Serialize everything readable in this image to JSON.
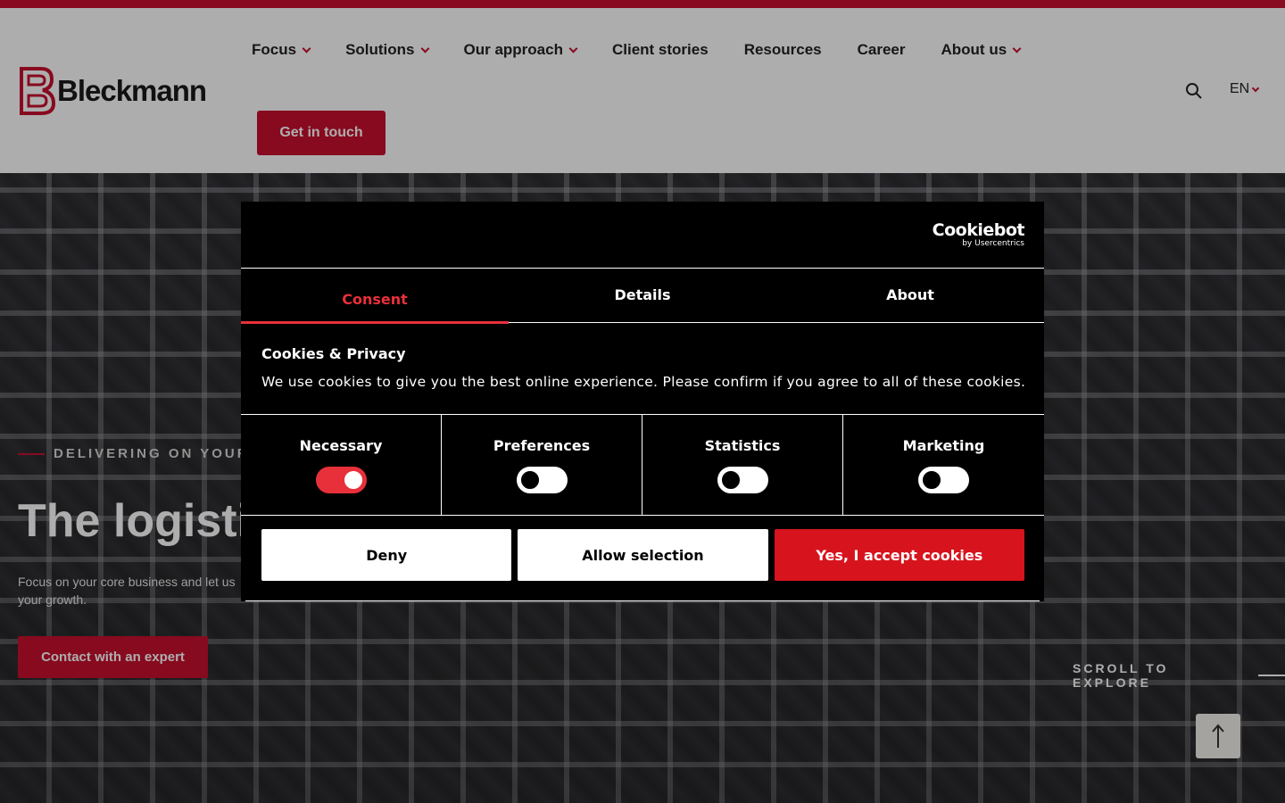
{
  "header": {
    "logo_text": "Bleckmann",
    "nav": [
      {
        "label": "Focus",
        "has_dropdown": true
      },
      {
        "label": "Solutions",
        "has_dropdown": true
      },
      {
        "label": "Our approach",
        "has_dropdown": true
      },
      {
        "label": "Client stories",
        "has_dropdown": false
      },
      {
        "label": "Resources",
        "has_dropdown": false
      },
      {
        "label": "Career",
        "has_dropdown": false
      },
      {
        "label": "About us",
        "has_dropdown": true
      }
    ],
    "cta_label": "Get in touch",
    "search_icon": "search-icon",
    "language": "EN"
  },
  "hero": {
    "eyebrow": "DELIVERING ON YOUR PI",
    "title": "The logistic",
    "text": "Focus on your core business and let us",
    "text_line2": "your growth.",
    "cta_label": "Contact with an expert",
    "scroll_label": "SCROLL TO EXPLORE",
    "to_top_icon": "arrow-up-icon"
  },
  "cookie_dialog": {
    "brand": "Cookiebot",
    "brand_sub": "by Usercentrics",
    "tabs": [
      {
        "label": "Consent",
        "active": true
      },
      {
        "label": "Details",
        "active": false
      },
      {
        "label": "About",
        "active": false
      }
    ],
    "title": "Cookies & Privacy",
    "text": "We use cookies to give you the best online experience. Please confirm if you agree to all of these cookies.",
    "categories": [
      {
        "label": "Necessary",
        "enabled": true
      },
      {
        "label": "Preferences",
        "enabled": false
      },
      {
        "label": "Statistics",
        "enabled": false
      },
      {
        "label": "Marketing",
        "enabled": false
      }
    ],
    "buttons": {
      "deny": "Deny",
      "allow_selection": "Allow selection",
      "accept": "Yes, I accept cookies"
    }
  },
  "colors": {
    "brand_red": "#c8102e",
    "accent_red": "#e8303a",
    "dialog_bg": "#000000"
  }
}
